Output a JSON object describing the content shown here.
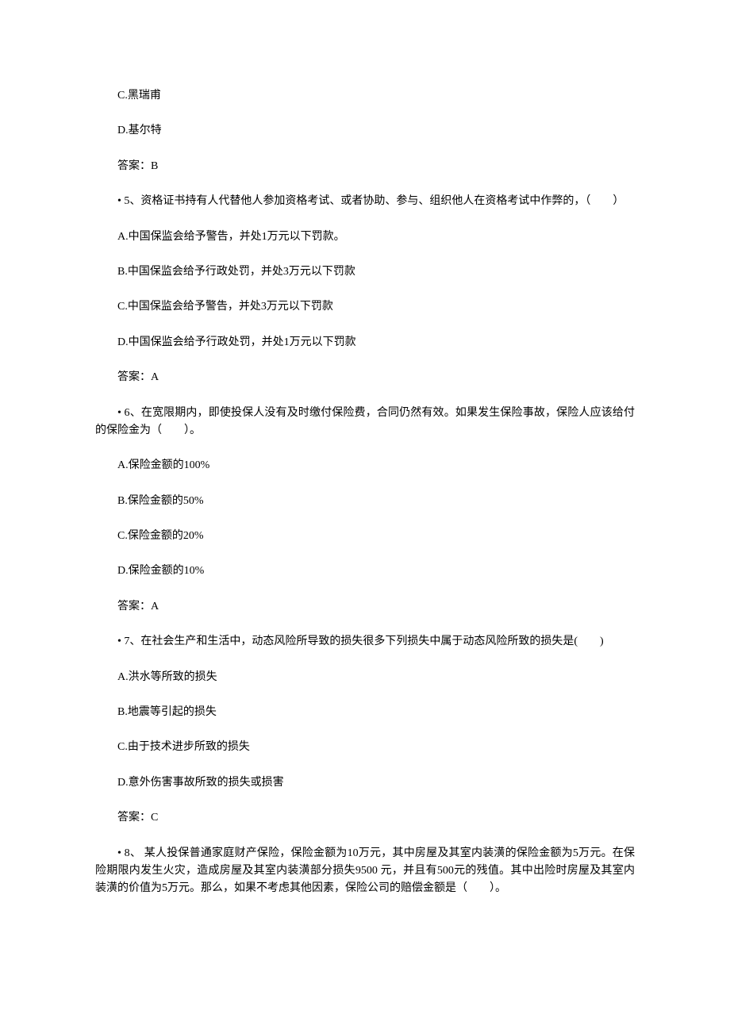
{
  "lines": {
    "q4_optC": "C.黑瑞甫",
    "q4_optD": "D.基尔特",
    "q4_answer": "答案：B",
    "q5_question": "• 5、资格证书持有人代替他人参加资格考试、或者协助、参与、组织他人在资格考试中作弊的，（　　）",
    "q5_optA": "A.中国保监会给予警告，并处1万元以下罚款。",
    "q5_optB": "B.中国保监会给予行政处罚，并处3万元以下罚款",
    "q5_optC": "C.中国保监会给予警告，并处3万元以下罚款",
    "q5_optD": "D.中国保监会给予行政处罚，并处1万元以下罚款",
    "q5_answer": "答案：A",
    "q6_question": "• 6、在宽限期内，即使投保人没有及时缴付保险费，合同仍然有效。如果发生保险事故，保险人应该给付的保险金为（　　）。",
    "q6_optA": "A.保险金额的100%",
    "q6_optB": "B.保险金额的50%",
    "q6_optC": "C.保险金额的20%",
    "q6_optD": "D.保险金额的10%",
    "q6_answer": "答案：A",
    "q7_question": "• 7、在社会生产和生活中，动态风险所导致的损失很多下列损失中属于动态风险所致的损失是(　　)",
    "q7_optA": "A.洪水等所致的损失",
    "q7_optB": "B.地震等引起的损失",
    "q7_optC": "C.由于技术进步所致的损失",
    "q7_optD": "D.意外伤害事故所致的损失或损害",
    "q7_answer": "答案：C",
    "q8_question": "• 8、 某人投保普通家庭财产保险，保险金额为10万元，其中房屋及其室内装潢的保险金额为5万元。在保险期限内发生火灾，造成房屋及其室内装潢部分损失9500 元，并且有500元的残值。其中出险时房屋及其室内装潢的价值为5万元。那么，如果不考虑其他因素，保险公司的赔偿金额是（　　）。"
  }
}
